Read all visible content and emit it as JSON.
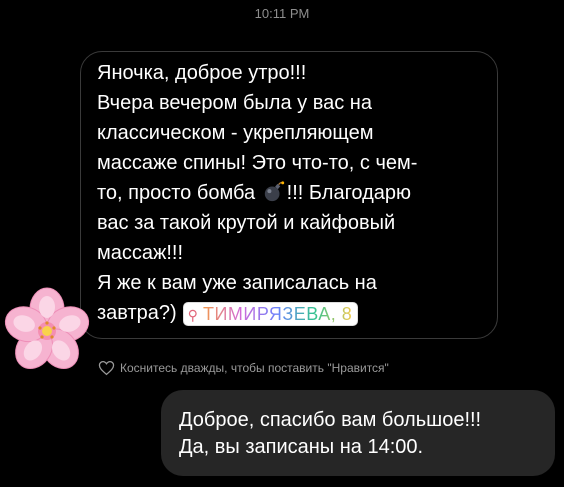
{
  "timestamp": "10:11 PM",
  "incoming": {
    "lines": [
      "Яночка, доброе утро!!!",
      "Вчера вечером была у вас на",
      "классическом - укрепляющем",
      "массаже спины! Это что-то, с чем-",
      "то, просто бомба",
      "!!! Благодарю",
      "вас за такой крутой и кайфовый",
      "массаж!!!",
      "Я же к вам уже записалась на",
      "завтра?)"
    ],
    "bomb_icon": "bomb-emoji-icon",
    "location_sticker": "ТИМИРЯЗЕВА, 8",
    "location_icon": "map-pin-icon",
    "avatar_icon": "pink-flower-icon"
  },
  "like_hint": "Коснитесь дважды, чтобы поставить \"Нравится\"",
  "outgoing": {
    "lines": [
      "Доброе, спасибо вам большое!!!",
      "Да, вы записаны на 14:00."
    ]
  },
  "colors": {
    "background": "#000000",
    "outgoing_bubble": "#262626",
    "incoming_border": "#3a3a3a",
    "muted_text": "#8e8e8e"
  }
}
